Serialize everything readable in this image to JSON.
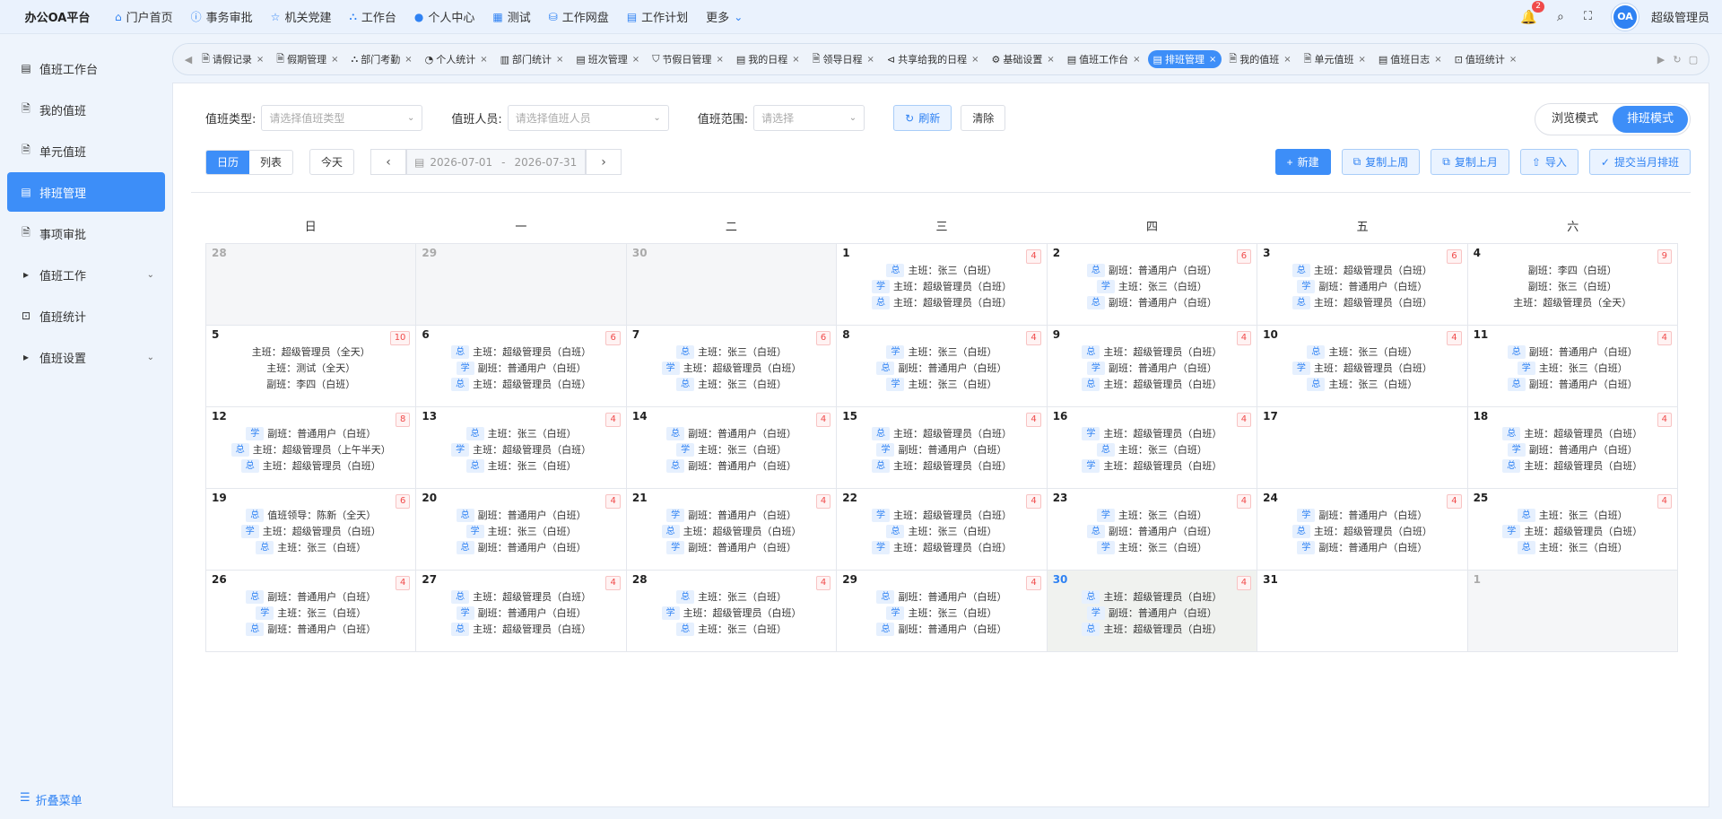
{
  "app": {
    "brand": "办公OA平台"
  },
  "topnav": [
    {
      "label": "门户首页",
      "icon": "home-icon",
      "glyph": "⌂"
    },
    {
      "label": "事务审批",
      "icon": "info-icon",
      "glyph": "ⓘ"
    },
    {
      "label": "机关党建",
      "icon": "star-icon",
      "glyph": "☆"
    },
    {
      "label": "工作台",
      "icon": "org-icon",
      "glyph": "⛬"
    },
    {
      "label": "个人中心",
      "icon": "user-icon",
      "glyph": "●"
    },
    {
      "label": "测试",
      "icon": "grid-icon",
      "glyph": "▦"
    },
    {
      "label": "工作网盘",
      "icon": "database-icon",
      "glyph": "⛁"
    },
    {
      "label": "工作计划",
      "icon": "calendar-icon",
      "glyph": "▤"
    },
    {
      "label": "更多",
      "icon": "chevron-down-icon",
      "glyph": "⌄"
    }
  ],
  "topright": {
    "notification_count": "2",
    "avatar_text": "OA",
    "username": "超级管理员"
  },
  "sidebar": [
    {
      "label": "值班工作台",
      "icon": "calendar-icon",
      "glyph": "▤",
      "active": false,
      "chev": false
    },
    {
      "label": "我的值班",
      "icon": "document-icon",
      "glyph": "🗎",
      "active": false,
      "chev": false
    },
    {
      "label": "单元值班",
      "icon": "document-icon",
      "glyph": "🗎",
      "active": false,
      "chev": false
    },
    {
      "label": "排班管理",
      "icon": "calendar-icon",
      "glyph": "▤",
      "active": true,
      "chev": false
    },
    {
      "label": "事项审批",
      "icon": "document-icon",
      "glyph": "🗎",
      "active": false,
      "chev": false
    },
    {
      "label": "值班工作",
      "icon": "caret-right-icon",
      "glyph": "▸",
      "active": false,
      "chev": true
    },
    {
      "label": "值班统计",
      "icon": "chart-icon",
      "glyph": "⊡",
      "active": false,
      "chev": false
    },
    {
      "label": "值班设置",
      "icon": "caret-right-icon",
      "glyph": "▸",
      "active": false,
      "chev": true
    }
  ],
  "collapse_label": "折叠菜单",
  "tabs": [
    {
      "label": "请假记录",
      "glyph": "🗎",
      "active": false
    },
    {
      "label": "假期管理",
      "glyph": "🗎",
      "active": false
    },
    {
      "label": "部门考勤",
      "glyph": "⛬",
      "active": false
    },
    {
      "label": "个人统计",
      "glyph": "◔",
      "active": false
    },
    {
      "label": "部门统计",
      "glyph": "▥",
      "active": false
    },
    {
      "label": "班次管理",
      "glyph": "▤",
      "active": false
    },
    {
      "label": "节假日管理",
      "glyph": "⛉",
      "active": false
    },
    {
      "label": "我的日程",
      "glyph": "▤",
      "active": false
    },
    {
      "label": "领导日程",
      "glyph": "🗎",
      "active": false
    },
    {
      "label": "共享给我的日程",
      "glyph": "⊲",
      "active": false
    },
    {
      "label": "基础设置",
      "glyph": "⚙",
      "active": false
    },
    {
      "label": "值班工作台",
      "glyph": "▤",
      "active": false
    },
    {
      "label": "排班管理",
      "glyph": "▤",
      "active": true
    },
    {
      "label": "我的值班",
      "glyph": "🗎",
      "active": false
    },
    {
      "label": "单元值班",
      "glyph": "🗎",
      "active": false
    },
    {
      "label": "值班日志",
      "glyph": "▤",
      "active": false
    },
    {
      "label": "值班统计",
      "glyph": "⊡",
      "active": false
    }
  ],
  "filters": {
    "type_label": "值班类型:",
    "type_placeholder": "请选择值班类型",
    "person_label": "值班人员:",
    "person_placeholder": "请选择值班人员",
    "range_label": "值班范围:",
    "range_placeholder": "请选择",
    "refresh": "刷新",
    "clear": "清除"
  },
  "modes": {
    "browse": "浏览模式",
    "schedule": "排班模式"
  },
  "view": {
    "calendar": "日历",
    "list": "列表",
    "today": "今天",
    "start": "2026-07-01",
    "sep": "-",
    "end": "2026-07-31"
  },
  "actions": {
    "new": "新建",
    "copy_week": "复制上周",
    "copy_month": "复制上月",
    "import": "导入",
    "submit": "提交当月排班"
  },
  "weekdays": [
    "日",
    "一",
    "二",
    "三",
    "四",
    "五",
    "六"
  ],
  "days": [
    {
      "d": "28",
      "o": true
    },
    {
      "d": "29",
      "o": true
    },
    {
      "d": "30",
      "o": true
    },
    {
      "d": "1",
      "c": "4",
      "e": [
        [
          "总",
          "主班：张三（白班）"
        ],
        [
          "学",
          "主班：超级管理员（白班）"
        ],
        [
          "总",
          "主班：超级管理员（白班）"
        ]
      ]
    },
    {
      "d": "2",
      "c": "6",
      "e": [
        [
          "总",
          "副班：普通用户（白班）"
        ],
        [
          "学",
          "主班：张三（白班）"
        ],
        [
          "总",
          "副班：普通用户（白班）"
        ]
      ]
    },
    {
      "d": "3",
      "c": "6",
      "e": [
        [
          "总",
          "主班：超级管理员（白班）"
        ],
        [
          "学",
          "副班：普通用户（白班）"
        ],
        [
          "总",
          "主班：超级管理员（白班）"
        ]
      ]
    },
    {
      "d": "4",
      "c": "9",
      "e": [
        [
          "",
          "副班：李四（白班）"
        ],
        [
          "",
          "副班：张三（白班）"
        ],
        [
          "",
          "主班：超级管理员（全天）"
        ]
      ]
    },
    {
      "d": "5",
      "c": "10",
      "e": [
        [
          "",
          "主班：超级管理员（全天）"
        ],
        [
          "",
          "主班：测试（全天）"
        ],
        [
          "",
          "副班：李四（白班）"
        ]
      ]
    },
    {
      "d": "6",
      "c": "6",
      "e": [
        [
          "总",
          "主班：超级管理员（白班）"
        ],
        [
          "学",
          "副班：普通用户（白班）"
        ],
        [
          "总",
          "主班：超级管理员（白班）"
        ]
      ]
    },
    {
      "d": "7",
      "c": "6",
      "e": [
        [
          "总",
          "主班：张三（白班）"
        ],
        [
          "学",
          "主班：超级管理员（白班）"
        ],
        [
          "总",
          "主班：张三（白班）"
        ]
      ]
    },
    {
      "d": "8",
      "c": "4",
      "e": [
        [
          "学",
          "主班：张三（白班）"
        ],
        [
          "总",
          "副班：普通用户（白班）"
        ],
        [
          "学",
          "主班：张三（白班）"
        ]
      ]
    },
    {
      "d": "9",
      "c": "4",
      "e": [
        [
          "总",
          "主班：超级管理员（白班）"
        ],
        [
          "学",
          "副班：普通用户（白班）"
        ],
        [
          "总",
          "主班：超级管理员（白班）"
        ]
      ]
    },
    {
      "d": "10",
      "c": "4",
      "e": [
        [
          "总",
          "主班：张三（白班）"
        ],
        [
          "学",
          "主班：超级管理员（白班）"
        ],
        [
          "总",
          "主班：张三（白班）"
        ]
      ]
    },
    {
      "d": "11",
      "c": "4",
      "e": [
        [
          "总",
          "副班：普通用户（白班）"
        ],
        [
          "学",
          "主班：张三（白班）"
        ],
        [
          "总",
          "副班：普通用户（白班）"
        ]
      ]
    },
    {
      "d": "12",
      "c": "8",
      "e": [
        [
          "学",
          "副班：普通用户（白班）"
        ],
        [
          "总",
          "主班：超级管理员（上午半天）"
        ],
        [
          "总",
          "主班：超级管理员（白班）"
        ]
      ]
    },
    {
      "d": "13",
      "c": "4",
      "e": [
        [
          "总",
          "主班：张三（白班）"
        ],
        [
          "学",
          "主班：超级管理员（白班）"
        ],
        [
          "总",
          "主班：张三（白班）"
        ]
      ]
    },
    {
      "d": "14",
      "c": "4",
      "e": [
        [
          "总",
          "副班：普通用户（白班）"
        ],
        [
          "学",
          "主班：张三（白班）"
        ],
        [
          "总",
          "副班：普通用户（白班）"
        ]
      ]
    },
    {
      "d": "15",
      "c": "4",
      "e": [
        [
          "总",
          "主班：超级管理员（白班）"
        ],
        [
          "学",
          "副班：普通用户（白班）"
        ],
        [
          "总",
          "主班：超级管理员（白班）"
        ]
      ]
    },
    {
      "d": "16",
      "c": "4",
      "e": [
        [
          "学",
          "主班：超级管理员（白班）"
        ],
        [
          "总",
          "主班：张三（白班）"
        ],
        [
          "学",
          "主班：超级管理员（白班）"
        ]
      ]
    },
    {
      "d": "17"
    },
    {
      "d": "18",
      "c": "4",
      "e": [
        [
          "总",
          "主班：超级管理员（白班）"
        ],
        [
          "学",
          "副班：普通用户（白班）"
        ],
        [
          "总",
          "主班：超级管理员（白班）"
        ]
      ]
    },
    {
      "d": "19",
      "c": "6",
      "e": [
        [
          "总",
          "值班领导：陈新（全天）"
        ],
        [
          "学",
          "主班：超级管理员（白班）"
        ],
        [
          "总",
          "主班：张三（白班）"
        ]
      ]
    },
    {
      "d": "20",
      "c": "4",
      "e": [
        [
          "总",
          "副班：普通用户（白班）"
        ],
        [
          "学",
          "主班：张三（白班）"
        ],
        [
          "总",
          "副班：普通用户（白班）"
        ]
      ]
    },
    {
      "d": "21",
      "c": "4",
      "e": [
        [
          "学",
          "副班：普通用户（白班）"
        ],
        [
          "总",
          "主班：超级管理员（白班）"
        ],
        [
          "学",
          "副班：普通用户（白班）"
        ]
      ]
    },
    {
      "d": "22",
      "c": "4",
      "e": [
        [
          "学",
          "主班：超级管理员（白班）"
        ],
        [
          "总",
          "主班：张三（白班）"
        ],
        [
          "学",
          "主班：超级管理员（白班）"
        ]
      ]
    },
    {
      "d": "23",
      "c": "4",
      "e": [
        [
          "学",
          "主班：张三（白班）"
        ],
        [
          "总",
          "副班：普通用户（白班）"
        ],
        [
          "学",
          "主班：张三（白班）"
        ]
      ]
    },
    {
      "d": "24",
      "c": "4",
      "e": [
        [
          "学",
          "副班：普通用户（白班）"
        ],
        [
          "总",
          "主班：超级管理员（白班）"
        ],
        [
          "学",
          "副班：普通用户（白班）"
        ]
      ]
    },
    {
      "d": "25",
      "c": "4",
      "e": [
        [
          "总",
          "主班：张三（白班）"
        ],
        [
          "学",
          "主班：超级管理员（白班）"
        ],
        [
          "总",
          "主班：张三（白班）"
        ]
      ]
    },
    {
      "d": "26",
      "c": "4",
      "e": [
        [
          "总",
          "副班：普通用户（白班）"
        ],
        [
          "学",
          "主班：张三（白班）"
        ],
        [
          "总",
          "副班：普通用户（白班）"
        ]
      ]
    },
    {
      "d": "27",
      "c": "4",
      "e": [
        [
          "总",
          "主班：超级管理员（白班）"
        ],
        [
          "学",
          "副班：普通用户（白班）"
        ],
        [
          "总",
          "主班：超级管理员（白班）"
        ]
      ]
    },
    {
      "d": "28",
      "c": "4",
      "e": [
        [
          "总",
          "主班：张三（白班）"
        ],
        [
          "学",
          "主班：超级管理员（白班）"
        ],
        [
          "总",
          "主班：张三（白班）"
        ]
      ]
    },
    {
      "d": "29",
      "c": "4",
      "e": [
        [
          "总",
          "副班：普通用户（白班）"
        ],
        [
          "学",
          "主班：张三（白班）"
        ],
        [
          "总",
          "副班：普通用户（白班）"
        ]
      ]
    },
    {
      "d": "30",
      "c": "4",
      "t": true,
      "e": [
        [
          "总",
          "主班：超级管理员（白班）"
        ],
        [
          "学",
          "副班：普通用户（白班）"
        ],
        [
          "总",
          "主班：超级管理员（白班）"
        ]
      ]
    },
    {
      "d": "31"
    },
    {
      "d": "1",
      "o": true
    }
  ]
}
